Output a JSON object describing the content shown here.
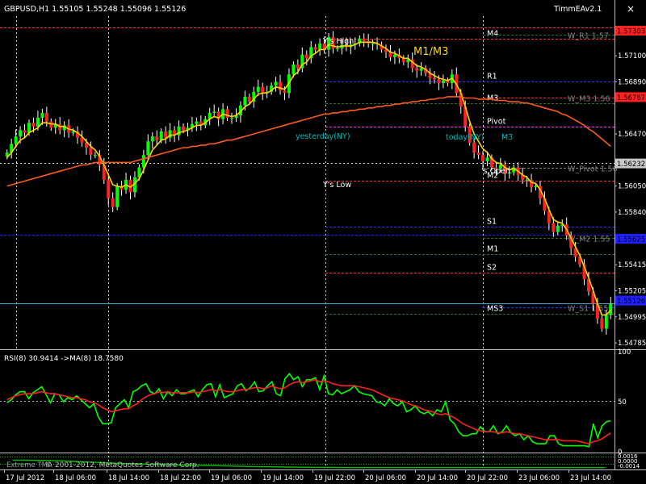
{
  "header": {
    "symbol_line": "GBPUSD,H1  1.55105  1.55248  1.55096  1.55126",
    "indicator_label": "TimmEAv2.1",
    "close_glyph": "×"
  },
  "chart_data": [
    {
      "type": "candlestick",
      "title": "GBPUSD,H1",
      "ylim": [
        1.5474,
        1.5742
      ],
      "y_ticks": [
        "1.57303",
        "1.57100",
        "1.56890",
        "1.56767",
        "1.56470",
        "1.56232",
        "1.56050",
        "1.55840",
        "1.55625",
        "1.55415",
        "1.55205",
        "1.54995",
        "1.54785"
      ],
      "x_ticks": [
        "17 Jul 2012",
        "18 Jul 06:00",
        "18 Jul 14:00",
        "18 Jul 22:00",
        "19 Jul 06:00",
        "19 Jul 14:00",
        "19 Jul 22:00",
        "20 Jul 06:00",
        "20 Jul 14:00",
        "20 Jul 22:00",
        "23 Jul 06:00",
        "23 Jul 14:00"
      ],
      "closes": [
        1.5632,
        1.5639,
        1.5645,
        1.565,
        1.5648,
        1.5656,
        1.5653,
        1.566,
        1.5664,
        1.5657,
        1.5652,
        1.5655,
        1.565,
        1.5654,
        1.5648,
        1.5649,
        1.5644,
        1.564,
        1.5636,
        1.563,
        1.563,
        1.5622,
        1.561,
        1.5595,
        1.5588,
        1.5605,
        1.5602,
        1.561,
        1.56,
        1.5612,
        1.562,
        1.563,
        1.5641,
        1.5645,
        1.5642,
        1.5649,
        1.5644,
        1.565,
        1.5646,
        1.5653,
        1.565,
        1.5652,
        1.5655,
        1.5657,
        1.5654,
        1.5659,
        1.5664,
        1.5665,
        1.5659,
        1.5667,
        1.566,
        1.566,
        1.5662,
        1.567,
        1.5677,
        1.5673,
        1.5681,
        1.5685,
        1.568,
        1.5681,
        1.5686,
        1.5689,
        1.5682,
        1.568,
        1.5695,
        1.5703,
        1.57,
        1.5711,
        1.5708,
        1.5717,
        1.5715,
        1.572,
        1.5715,
        1.5725,
        1.5716,
        1.5716,
        1.5719,
        1.5717,
        1.5719,
        1.572,
        1.5724,
        1.5722,
        1.572,
        1.572,
        1.5719,
        1.5715,
        1.5713,
        1.5709,
        1.5711,
        1.5708,
        1.5705,
        1.5707,
        1.57,
        1.5698,
        1.57,
        1.5696,
        1.5692,
        1.5691,
        1.5688,
        1.569,
        1.5688,
        1.5695,
        1.568,
        1.5669,
        1.5653,
        1.564,
        1.5632,
        1.563,
        1.5625,
        1.5628,
        1.562,
        1.5619,
        1.5622,
        1.5615,
        1.5616,
        1.562,
        1.5614,
        1.561,
        1.561,
        1.5604,
        1.5605,
        1.5595,
        1.5585,
        1.5575,
        1.5568,
        1.5573,
        1.5574,
        1.5565,
        1.5555,
        1.5548,
        1.5542,
        1.553,
        1.552,
        1.551,
        1.5498,
        1.549,
        1.5501,
        1.551
      ],
      "series": [
        {
          "name": "",
          "color": "#ffd400",
          "values": [
            1.5628,
            1.5632,
            1.5637,
            1.5642,
            1.5644,
            1.5648,
            1.565,
            1.5652,
            1.5656,
            1.5656,
            1.5655,
            1.5655,
            1.5653,
            1.5653,
            1.5651,
            1.565,
            1.5648,
            1.5645,
            1.5641,
            1.5637,
            1.5634,
            1.5629,
            1.5622,
            1.5614,
            1.5606,
            1.5605,
            1.5604,
            1.5606,
            1.5604,
            1.5607,
            1.5611,
            1.5618,
            1.5626,
            1.5634,
            1.5638,
            1.5642,
            1.5643,
            1.5646,
            1.5646,
            1.5648,
            1.5649,
            1.565,
            1.5652,
            1.5654,
            1.5654,
            1.5656,
            1.5659,
            1.5661,
            1.566,
            1.5663,
            1.5662,
            1.5661,
            1.5662,
            1.5665,
            1.5669,
            1.5671,
            1.5675,
            1.5679,
            1.568,
            1.568,
            1.5682,
            1.5685,
            1.5684,
            1.5683,
            1.5688,
            1.5694,
            1.5697,
            1.5703,
            1.5705,
            1.571,
            1.5712,
            1.5715,
            1.5715,
            1.5719,
            1.5718,
            1.5717,
            1.5718,
            1.5718,
            1.5718,
            1.5719,
            1.5721,
            1.5721,
            1.5721,
            1.5721,
            1.572,
            1.5718,
            1.5716,
            1.5713,
            1.5712,
            1.571,
            1.5708,
            1.5708,
            1.5705,
            1.5702,
            1.5701,
            1.5699,
            1.5696,
            1.5694,
            1.5692,
            1.5691,
            1.569,
            1.5692,
            1.5687,
            1.568,
            1.5669,
            1.5657,
            1.5647,
            1.5641,
            1.5635,
            1.5632,
            1.5627,
            1.5624,
            1.5623,
            1.562,
            1.5618,
            1.5619,
            1.5617,
            1.5614,
            1.5612,
            1.5608,
            1.5607,
            1.5602,
            1.5595,
            1.5586,
            1.5578,
            1.5576,
            1.5575,
            1.557,
            1.5563,
            1.5556,
            1.5549,
            1.554,
            1.5531,
            1.5521,
            1.551,
            1.5501,
            1.5501,
            1.5505
          ]
        },
        {
          "name": "",
          "color": "#ff5a1e",
          "values": [
            1.5605,
            1.5606,
            1.5607,
            1.5608,
            1.5609,
            1.561,
            1.5611,
            1.5612,
            1.5613,
            1.5614,
            1.5615,
            1.5616,
            1.5617,
            1.5618,
            1.5619,
            1.562,
            1.5621,
            1.5622,
            1.5622,
            1.5623,
            1.5624,
            1.5624,
            1.5624,
            1.5624,
            1.5624,
            1.5624,
            1.5624,
            1.5624,
            1.5624,
            1.5625,
            1.5626,
            1.5627,
            1.5628,
            1.5629,
            1.563,
            1.5631,
            1.5632,
            1.5633,
            1.5634,
            1.5635,
            1.5636,
            1.5636,
            1.5637,
            1.5637,
            1.5638,
            1.5638,
            1.5639,
            1.5639,
            1.564,
            1.5641,
            1.5642,
            1.5642,
            1.5643,
            1.5644,
            1.5645,
            1.5646,
            1.5647,
            1.5648,
            1.5649,
            1.565,
            1.5651,
            1.5652,
            1.5653,
            1.5654,
            1.5655,
            1.5656,
            1.5657,
            1.5658,
            1.5659,
            1.566,
            1.5661,
            1.5662,
            1.5663,
            1.5663,
            1.5664,
            1.5664,
            1.5665,
            1.5665,
            1.5666,
            1.5666,
            1.5667,
            1.5667,
            1.5668,
            1.5668,
            1.5669,
            1.5669,
            1.567,
            1.567,
            1.5671,
            1.5671,
            1.5672,
            1.5672,
            1.5673,
            1.5673,
            1.5674,
            1.5674,
            1.5675,
            1.5675,
            1.5676,
            1.5676,
            1.5677,
            1.5677,
            1.5677,
            1.5677,
            1.5676,
            1.5676,
            1.5676,
            1.5675,
            1.5675,
            1.5675,
            1.5675,
            1.5674,
            1.5674,
            1.5674,
            1.5673,
            1.5673,
            1.5673,
            1.5672,
            1.5672,
            1.5671,
            1.567,
            1.5669,
            1.5668,
            1.5667,
            1.5666,
            1.5665,
            1.5663,
            1.5662,
            1.566,
            1.5658,
            1.5656,
            1.5654,
            1.5651,
            1.5649,
            1.5646,
            1.5643,
            1.564,
            1.5637
          ]
        }
      ],
      "levels": [
        {
          "label": "M4",
          "price": 1.5724,
          "color": "#ff3030",
          "side": "right"
        },
        {
          "label": "W_R1 1.57",
          "price": 1.5727,
          "color": "#2a6e2a",
          "side": "far"
        },
        {
          "label": "R1",
          "price": 1.5689,
          "color": "#3030ff",
          "side": "right"
        },
        {
          "label": "W_M3 1.56",
          "price": 1.5676,
          "color": "#ff3030",
          "side": "far"
        },
        {
          "label": "M3",
          "price": 1.5672,
          "color": "#2a6e2a",
          "side": "right"
        },
        {
          "label": "Pivot",
          "price": 1.5653,
          "color": "#ff30ff",
          "side": "right"
        },
        {
          "label": "W_Pivot 1.56",
          "price": 1.562,
          "color": "#808080",
          "side": "far"
        },
        {
          "label": "M2",
          "price": 1.5609,
          "color": "#ff3030",
          "side": "right"
        },
        {
          "label": "S1",
          "price": 1.5572,
          "color": "#3030ff",
          "side": "right"
        },
        {
          "label": "W_M2 1.55",
          "price": 1.5563,
          "color": "#2a6e2a",
          "side": "far"
        },
        {
          "label": "M1",
          "price": 1.555,
          "color": "#2a6e2a",
          "side": "right"
        },
        {
          "label": "S2",
          "price": 1.5535,
          "color": "#ff3030",
          "side": "right"
        },
        {
          "label": "W_S1 1.55",
          "price": 1.5507,
          "color": "#3030ff",
          "side": "far"
        },
        {
          "label": "MS3",
          "price": 1.5502,
          "color": "#2a6e2a",
          "side": "right"
        }
      ],
      "price_tags": [
        {
          "text": "1.57303",
          "price": 1.57303,
          "bg": "#ff2020",
          "fg": "#000000"
        },
        {
          "text": "1.56767",
          "price": 1.56767,
          "bg": "#ff2020",
          "fg": "#000000"
        },
        {
          "text": "1.56232",
          "price": 1.56232,
          "bg": "#c8c8c8",
          "fg": "#000000"
        },
        {
          "text": "1.55625",
          "price": 1.55625,
          "bg": "#2020ff",
          "fg": "#000000"
        },
        {
          "text": "1.55126",
          "price": 1.55126,
          "bg": "#2020ff",
          "fg": "#000000"
        }
      ],
      "annotations": {
        "ys_high": "Y's High",
        "ys_low": "Y's Low",
        "mma": "M1/M3",
        "yesterday": "yesterday(NY)",
        "today": "today(NY)",
        "ym3": "M3",
        "ds_open": "'s Open"
      }
    },
    {
      "type": "line",
      "title": "RSI(8) 30.9414  ->MA(8) 18.7580",
      "ylim": [
        0,
        100
      ],
      "y_ticks": [
        "100",
        "50",
        "0"
      ],
      "series": [
        {
          "name": "RSI(8)",
          "color": "#00ff00",
          "values": [
            49,
            52,
            57,
            60,
            60,
            53,
            59,
            62,
            65,
            57,
            49,
            58,
            57,
            50,
            54,
            52,
            56,
            52,
            48,
            44,
            48,
            35,
            28,
            28,
            29,
            44,
            48,
            52,
            44,
            60,
            62,
            66,
            68,
            60,
            58,
            63,
            53,
            60,
            56,
            62,
            58,
            58,
            60,
            62,
            55,
            62,
            67,
            68,
            55,
            67,
            54,
            56,
            58,
            66,
            68,
            61,
            64,
            70,
            60,
            61,
            66,
            70,
            58,
            56,
            73,
            78,
            72,
            75,
            65,
            72,
            72,
            74,
            62,
            76,
            58,
            57,
            62,
            58,
            60,
            62,
            66,
            60,
            58,
            57,
            56,
            50,
            49,
            46,
            53,
            48,
            46,
            50,
            40,
            42,
            46,
            40,
            38,
            40,
            36,
            42,
            40,
            50,
            32,
            28,
            20,
            16,
            16,
            18,
            18,
            25,
            20,
            20,
            26,
            18,
            20,
            26,
            19,
            16,
            18,
            12,
            16,
            10,
            8,
            8,
            8,
            16,
            16,
            8,
            6,
            6,
            6,
            6,
            6,
            6,
            5,
            28,
            14,
            26,
            30,
            31
          ]
        },
        {
          "name": "MA(8)",
          "color": "#ff2020",
          "values": [
            52,
            54,
            56,
            57,
            58,
            58,
            58,
            59,
            60,
            59,
            58,
            58,
            57,
            56,
            55,
            54,
            54,
            53,
            52,
            50,
            49,
            47,
            44,
            42,
            40,
            41,
            42,
            43,
            43,
            46,
            48,
            52,
            55,
            57,
            58,
            60,
            59,
            60,
            59,
            59,
            59,
            59,
            59,
            60,
            59,
            60,
            61,
            62,
            61,
            62,
            61,
            60,
            60,
            61,
            62,
            62,
            63,
            64,
            64,
            63,
            64,
            66,
            64,
            63,
            64,
            67,
            69,
            70,
            69,
            70,
            71,
            72,
            70,
            71,
            70,
            68,
            67,
            66,
            66,
            66,
            66,
            65,
            64,
            63,
            62,
            60,
            58,
            56,
            54,
            53,
            52,
            51,
            49,
            47,
            46,
            44,
            42,
            41,
            40,
            38,
            37,
            38,
            36,
            34,
            31,
            28,
            26,
            24,
            22,
            21,
            20,
            20,
            20,
            19,
            19,
            20,
            19,
            18,
            18,
            17,
            16,
            15,
            14,
            13,
            12,
            12,
            12,
            12,
            11,
            11,
            11,
            11,
            10,
            9,
            8,
            10,
            11,
            13,
            16,
            18.76
          ]
        }
      ]
    },
    {
      "type": "line",
      "title": "",
      "ylim": [
        0,
        100
      ],
      "y_ticks": [
        "0.0016",
        "0.0000",
        "-0.0014"
      ],
      "series": [
        {
          "name": "",
          "color": "#00c000",
          "values": [
            60,
            60,
            58,
            55,
            50,
            45,
            40,
            35,
            32,
            28,
            25,
            22,
            20,
            18,
            15,
            12,
            10,
            8,
            6,
            5,
            4,
            3,
            2,
            2,
            2,
            2,
            2,
            2,
            2,
            2,
            2,
            2,
            2,
            2,
            2,
            2,
            2,
            2,
            2,
            2
          ]
        }
      ],
      "watermark": "Extreme TMA"
    }
  ],
  "footer": {
    "copyright": "© 2001-2012, MetaQuotes Software Corp."
  }
}
